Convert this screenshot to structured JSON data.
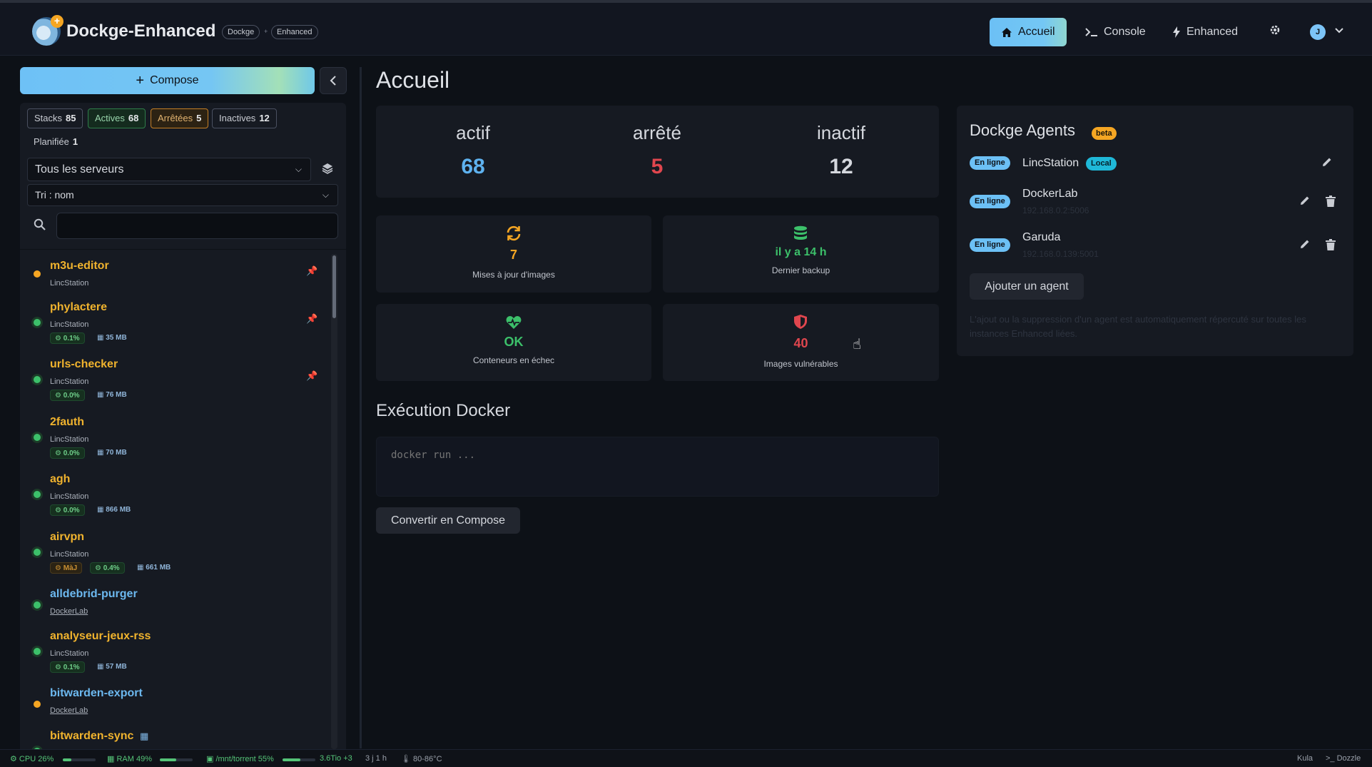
{
  "header": {
    "brand": "Dockge-Enhanced",
    "badge_dockge": "Dockge",
    "badge_sep": "+",
    "badge_enhanced": "Enhanced",
    "nav": [
      {
        "label": "Accueil",
        "icon": "home-icon"
      },
      {
        "label": "Console",
        "icon": "terminal-icon"
      },
      {
        "label": "Enhanced",
        "icon": "bolt-icon"
      }
    ],
    "avatar_initial": "J",
    "accent_color": "#6cc0f5"
  },
  "sidebar": {
    "compose_label": "Compose",
    "filters": {
      "stacks": {
        "label": "Stacks",
        "count": "85"
      },
      "actives": {
        "label": "Actives",
        "count": "68"
      },
      "arretees": {
        "label": "Arrêtées",
        "count": "5"
      },
      "inactives": {
        "label": "Inactives",
        "count": "12"
      },
      "planifiee": {
        "label": "Planifiée",
        "count": "1"
      }
    },
    "server_select": "Tous les serveurs",
    "sort_select": "Tri : nom",
    "search_value": "",
    "stacks": [
      {
        "name": "m3u-editor",
        "server": "LincStation",
        "status": "orange",
        "pinned": true
      },
      {
        "name": "phylactere",
        "server": "LincStation",
        "status": "green",
        "pinned": true,
        "cpu": "0.1%",
        "mem": "35 MB"
      },
      {
        "name": "urls-checker",
        "server": "LincStation",
        "status": "green",
        "pinned": true,
        "cpu": "0.0%",
        "mem": "76 MB"
      },
      {
        "name": "2fauth",
        "server": "LincStation",
        "status": "green",
        "cpu": "0.0%",
        "mem": "70 MB"
      },
      {
        "name": "agh",
        "server": "LincStation",
        "status": "green",
        "cpu": "0.0%",
        "mem": "866 MB"
      },
      {
        "name": "airvpn",
        "server": "LincStation",
        "status": "green",
        "update": "MàJ",
        "cpu": "0.4%",
        "mem": "661 MB"
      },
      {
        "name": "alldebrid-purger",
        "server": "DockerLab",
        "status": "green"
      },
      {
        "name": "analyseur-jeux-rss",
        "server": "LincStation",
        "status": "green",
        "cpu": "0.1%",
        "mem": "57 MB"
      },
      {
        "name": "bitwarden-export",
        "server": "DockerLab",
        "status": "orange"
      },
      {
        "name": "bitwarden-sync",
        "server": "",
        "status": "green",
        "scheduled": true
      }
    ]
  },
  "main": {
    "title": "Accueil",
    "stats": {
      "actif": {
        "label": "actif",
        "value": "68",
        "color": "#5eb2ef"
      },
      "arrete": {
        "label": "arrêté",
        "value": "5",
        "color": "#e0464e"
      },
      "inactif": {
        "label": "inactif",
        "value": "12",
        "color": "#d5d8de"
      }
    },
    "cards": {
      "updates": {
        "value": "7",
        "label": "Mises à jour d'images",
        "icon": "sync-icon",
        "color": "#f5a623"
      },
      "backup": {
        "value": "il y a 14 h",
        "label": "Dernier backup",
        "icon": "database-icon",
        "color": "#3cc06a"
      },
      "failing": {
        "value": "OK",
        "label": "Conteneurs en échec",
        "icon": "heartbeat-icon",
        "color": "#3cc06a"
      },
      "vulns": {
        "value": "40",
        "label": "Images vulnérables",
        "icon": "shield-icon",
        "color": "#e0464e"
      }
    },
    "agents": {
      "title": "Dockge Agents",
      "beta": "beta",
      "online_label": "En ligne",
      "local_label": "Local",
      "list": [
        {
          "name": "LincStation",
          "ip": "",
          "local": true
        },
        {
          "name": "DockerLab",
          "ip": "192.168.0.2:5006"
        },
        {
          "name": "Garuda",
          "ip": "192.168.0.139:5001"
        }
      ],
      "add_label": "Ajouter un agent",
      "note": "L'ajout ou la suppression d'un agent est automatiquement répercuté sur toutes les instances Enhanced liées."
    },
    "docker_run": {
      "title": "Exécution Docker",
      "placeholder": "docker run ...",
      "convert_label": "Convertir en Compose"
    }
  },
  "footer": {
    "cpu": "CPU 26%",
    "cpu_level": 0.26,
    "ram": "RAM 49%",
    "ram_level": 0.49,
    "disk": "/mnt/torrent 55%",
    "disk_level": 0.55,
    "disk_size": "3.6Tio +3",
    "uptime": "3 j 1 h",
    "temp": "80-86°C",
    "kula": "Kula",
    "dozzle": "Dozzle"
  }
}
